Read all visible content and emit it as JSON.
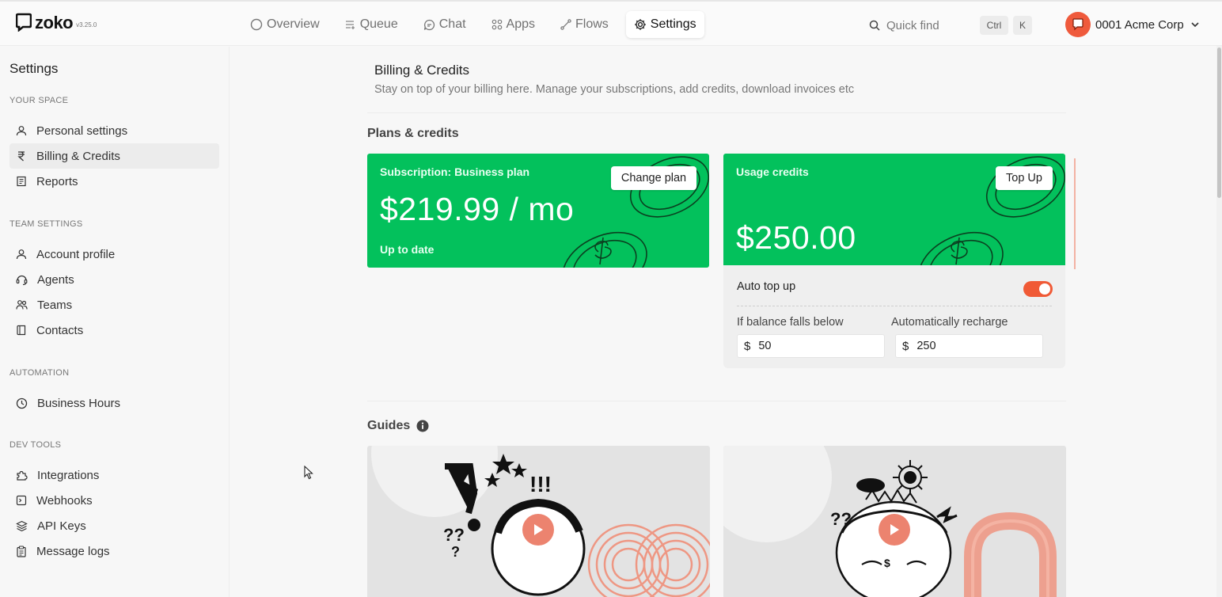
{
  "app": {
    "logo_text": "zoko",
    "version": "v3.25.0"
  },
  "nav": {
    "items": [
      {
        "label": "Overview",
        "icon": "circle-icon"
      },
      {
        "label": "Queue",
        "icon": "queue-icon"
      },
      {
        "label": "Chat",
        "icon": "chat-icon"
      },
      {
        "label": "Apps",
        "icon": "apps-grid-icon"
      },
      {
        "label": "Flows",
        "icon": "flows-icon"
      },
      {
        "label": "Settings",
        "icon": "gear-icon",
        "active": true
      }
    ]
  },
  "quick_find": {
    "placeholder": "Quick find",
    "shortcut_ctrl": "Ctrl",
    "shortcut_key": "K"
  },
  "account": {
    "name": "0001 Acme Corp",
    "avatar_color": "#ef5a3c"
  },
  "sidebar": {
    "title": "Settings",
    "sections": [
      {
        "title": "YOUR SPACE",
        "items": [
          {
            "label": "Personal settings",
            "icon": "user-icon"
          },
          {
            "label": "Billing & Credits",
            "icon": "rupee-icon",
            "active": true
          },
          {
            "label": "Reports",
            "icon": "report-icon"
          }
        ]
      },
      {
        "title": "TEAM SETTINGS",
        "items": [
          {
            "label": "Account profile",
            "icon": "user-icon"
          },
          {
            "label": "Agents",
            "icon": "agent-icon"
          },
          {
            "label": "Teams",
            "icon": "team-icon"
          },
          {
            "label": "Contacts",
            "icon": "contacts-book-icon"
          }
        ]
      },
      {
        "title": "AUTOMATION",
        "items": [
          {
            "label": "Business Hours",
            "icon": "clock-icon"
          }
        ]
      },
      {
        "title": "DEV TOOLS",
        "items": [
          {
            "label": "Integrations",
            "icon": "puzzle-icon"
          },
          {
            "label": "Webhooks",
            "icon": "terminal-icon"
          },
          {
            "label": "API Keys",
            "icon": "layers-icon"
          },
          {
            "label": "Message logs",
            "icon": "clipboard-icon"
          }
        ]
      }
    ]
  },
  "page": {
    "title": "Billing & Credits",
    "description": "Stay on top of your billing here. Manage your subscriptions, add credits, download invoices etc"
  },
  "plans": {
    "section_title": "Plans & credits",
    "subscription": {
      "label": "Subscription: Business plan",
      "amount": "$219.99 / mo",
      "status": "Up to date",
      "button": "Change plan"
    },
    "usage": {
      "label": "Usage credits",
      "amount": "$250.00",
      "button": "Top Up"
    },
    "auto_top_up": {
      "label": "Auto top up",
      "enabled": true,
      "threshold_label": "If balance falls below",
      "threshold_currency": "$",
      "threshold_value": "50",
      "recharge_label": "Automatically recharge",
      "recharge_currency": "$",
      "recharge_value": "250"
    }
  },
  "guides": {
    "section_title": "Guides"
  },
  "colors": {
    "card_green": "#03c15c",
    "accent_orange": "#f05a36"
  }
}
